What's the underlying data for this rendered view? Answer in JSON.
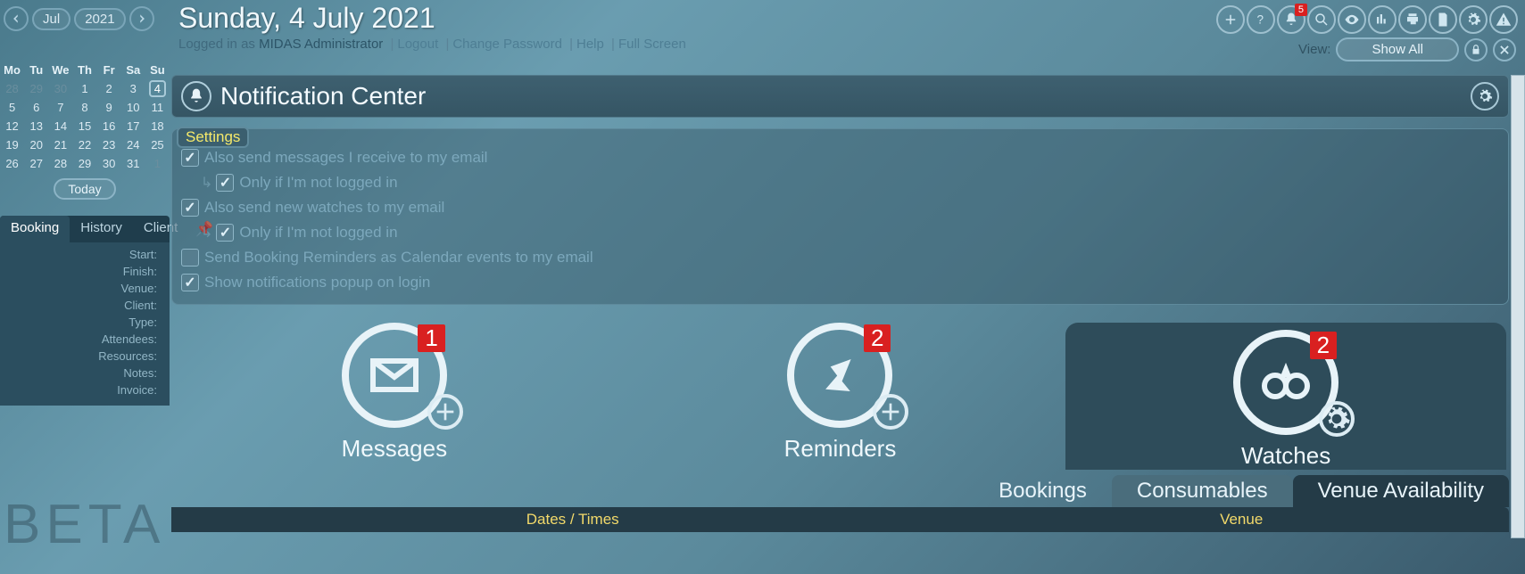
{
  "header": {
    "month": "Jul",
    "year": "2021",
    "title": "Sunday, 4 July 2021",
    "loggedInPrefix": "Logged in as ",
    "userName": "MIDAS Administrator",
    "links": [
      "Logout",
      "Change Password",
      "Help",
      "Full Screen"
    ],
    "viewLabel": "View:",
    "viewValue": "Show All",
    "bellBadge": "5"
  },
  "calendar": {
    "dow": [
      "Mo",
      "Tu",
      "We",
      "Th",
      "Fr",
      "Sa",
      "Su"
    ],
    "rows": [
      [
        {
          "d": "28",
          "dim": true
        },
        {
          "d": "29",
          "dim": true
        },
        {
          "d": "30",
          "dim": true
        },
        {
          "d": "1"
        },
        {
          "d": "2"
        },
        {
          "d": "3"
        },
        {
          "d": "4",
          "sel": true
        }
      ],
      [
        {
          "d": "5"
        },
        {
          "d": "6"
        },
        {
          "d": "7"
        },
        {
          "d": "8"
        },
        {
          "d": "9"
        },
        {
          "d": "10"
        },
        {
          "d": "11"
        }
      ],
      [
        {
          "d": "12"
        },
        {
          "d": "13"
        },
        {
          "d": "14"
        },
        {
          "d": "15"
        },
        {
          "d": "16"
        },
        {
          "d": "17"
        },
        {
          "d": "18"
        }
      ],
      [
        {
          "d": "19"
        },
        {
          "d": "20"
        },
        {
          "d": "21"
        },
        {
          "d": "22"
        },
        {
          "d": "23"
        },
        {
          "d": "24"
        },
        {
          "d": "25"
        }
      ],
      [
        {
          "d": "26"
        },
        {
          "d": "27"
        },
        {
          "d": "28"
        },
        {
          "d": "29"
        },
        {
          "d": "30"
        },
        {
          "d": "31"
        },
        {
          "d": "1",
          "dim": true
        }
      ]
    ],
    "today": "Today"
  },
  "sideTabs": [
    "Booking",
    "History",
    "Client"
  ],
  "fields": [
    "Start:",
    "Finish:",
    "Venue:",
    "Client:",
    "Type:",
    "Attendees:",
    "Resources:",
    "Notes:",
    "Invoice:"
  ],
  "panel": {
    "title": "Notification Center",
    "settingsLabel": "Settings",
    "opts": [
      {
        "text": "Also send messages I receive to my email",
        "on": true,
        "indent": false
      },
      {
        "text": "Only if I'm not logged in",
        "on": true,
        "indent": true
      },
      {
        "text": "Also send new watches to my email",
        "on": true,
        "indent": false
      },
      {
        "text": "Only if I'm not logged in",
        "on": true,
        "indent": true
      },
      {
        "text": "Send Booking Reminders as Calendar events to my email",
        "on": false,
        "indent": false
      },
      {
        "text": "Show notifications popup on login",
        "on": true,
        "indent": false
      }
    ]
  },
  "big": [
    {
      "label": "Messages",
      "badge": "1",
      "extra": "plus"
    },
    {
      "label": "Reminders",
      "badge": "2",
      "extra": "plus"
    },
    {
      "label": "Watches",
      "badge": "2",
      "extra": "gear",
      "active": true
    }
  ],
  "subtabs": [
    "Bookings",
    "Consumables",
    "Venue Availability"
  ],
  "footer": [
    "Dates / Times",
    "Venue"
  ],
  "beta": "BETA"
}
